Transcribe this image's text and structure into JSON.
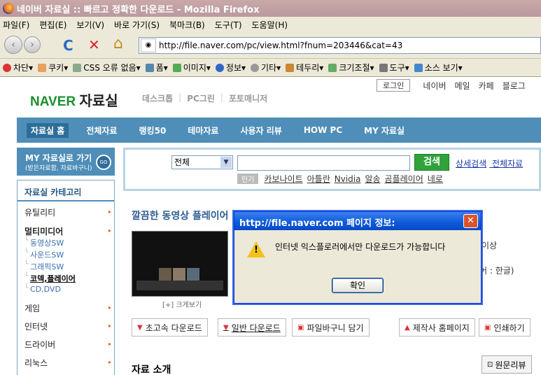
{
  "window": {
    "title": "네이버 자료실 :: 빠르고 정확한 다운로드 - Mozilla Firefox"
  },
  "menu": [
    "파일(F)",
    "편집(E)",
    "보기(V)",
    "바로 가기(S)",
    "북마크(B)",
    "도구(T)",
    "도움말(H)"
  ],
  "nav": {
    "url": "http://file.naver.com/pc/view.html?fnum=203446&cat=43",
    "reload_glyph": "C",
    "stop_glyph": "✕",
    "home_glyph": "⌂",
    "back_glyph": "‹",
    "forward_glyph": "›"
  },
  "bookmarks": [
    {
      "label": "차단",
      "color": "#d33"
    },
    {
      "label": "쿠키",
      "color": "#e8a060"
    },
    {
      "label": "CSS 오류 없음",
      "color": "#8a8"
    },
    {
      "label": "폼",
      "color": "#58a"
    },
    {
      "label": "이미지",
      "color": "#5a5"
    },
    {
      "label": "정보",
      "color": "#36c"
    },
    {
      "label": "기타",
      "color": "#999"
    },
    {
      "label": "테두리",
      "color": "#c83"
    },
    {
      "label": "크기조절",
      "color": "#6a6"
    },
    {
      "label": "도구",
      "color": "#777"
    },
    {
      "label": "소스 보기",
      "color": "#48c"
    }
  ],
  "site": {
    "logo_brand": "NAVER",
    "logo_section": "자료실",
    "subnav": [
      "데스크톱",
      "PC그린",
      "포토매니저"
    ],
    "login": "로그인",
    "toplinks": [
      "네이버",
      "메일",
      "카페",
      "블로그"
    ],
    "gnb": [
      "자료실 홈",
      "전체자료",
      "랭킹50",
      "테마자료",
      "사용자 리뷰",
      "HOW PC",
      "MY 자료실"
    ],
    "mybox": {
      "title": "MY 자료실로 가기",
      "sub": "(받은자료함, 자료바구니)",
      "go": "GO"
    },
    "category_title": "자료실 카테고리",
    "categories": {
      "c1": "유틸리티",
      "c2": "멀티미디어",
      "s1": "동영상SW",
      "s2": "사운드SW",
      "s3": "그래픽SW",
      "s4": "코덱,플레이어",
      "s5": "CD,DVD",
      "c3": "게임",
      "c4": "인터넷",
      "c5": "드라이버",
      "c6": "리눅스"
    },
    "search": {
      "select": "전체",
      "button": "검색",
      "links": [
        "상세검색",
        "전체자료"
      ],
      "popular_tag": "인기",
      "popular": [
        "카보나이트",
        "아틀란",
        "Nvidia",
        "알송",
        "곰플레이어",
        "네로"
      ]
    },
    "content_title": "깔끔한 동영상 플레이어",
    "enlarge": "[+] 크게보기",
    "right_text1": "이상",
    "right_text2": "어 : 한글)",
    "buttons": [
      "초고속 다운로드",
      "일반 다운로드",
      "파일바구니 담기",
      "제작사 홈페이지",
      "인쇄하기"
    ],
    "intro": "자료 소개",
    "review": "원문리뷰"
  },
  "dialog": {
    "title": "http://file.naver.com 페이지 정보:",
    "message": "인터넷 익스플로러에서만 다운로드가 가능합니다",
    "ok": "확인",
    "close": "✕"
  }
}
